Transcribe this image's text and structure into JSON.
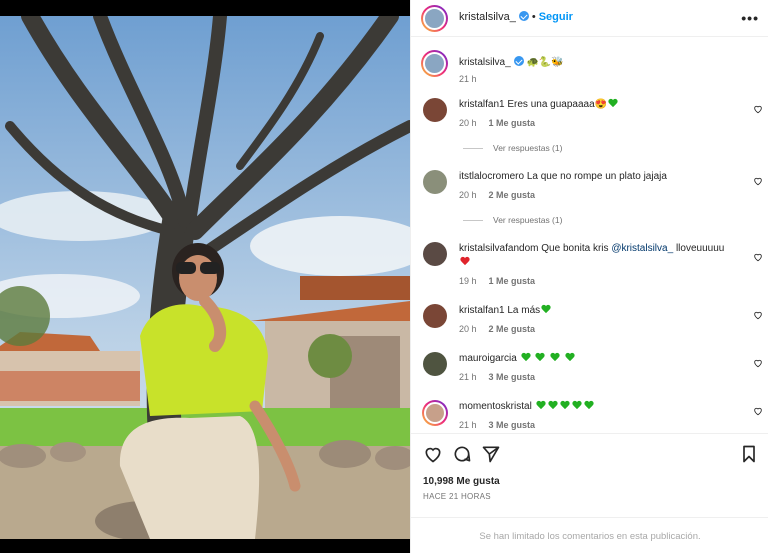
{
  "header": {
    "username": "kristalsilva_",
    "follow_label": "Seguir",
    "more_label": "•••"
  },
  "caption": {
    "username": "kristalsilva_",
    "emojis": "🐢🐍🐝",
    "time": "21 h"
  },
  "comments": [
    {
      "user": "kristalfan1",
      "text": "Eres una guapaaaa😍",
      "time": "20 h",
      "likes": "1 Me gusta",
      "replies": "Ver respuestas (1)"
    },
    {
      "user": "itstlalocromero",
      "text": "La que no rompe un plato jajaja",
      "time": "20 h",
      "likes": "2 Me gusta",
      "replies": "Ver respuestas (1)"
    },
    {
      "user": "kristalsilvafandom",
      "text": "Que bonita kris",
      "mention": "@kristalsilva_",
      "text2": "lloveuuuuu",
      "time": "19 h",
      "likes": "1 Me gusta"
    },
    {
      "user": "kristalfan1",
      "text": "La más",
      "time": "20 h",
      "likes": "2 Me gusta"
    },
    {
      "user": "mauroigarcia",
      "text": "",
      "time": "21 h",
      "likes": "3 Me gusta"
    },
    {
      "user": "momentoskristal",
      "text": "",
      "time": "21 h",
      "likes": "3 Me gusta"
    }
  ],
  "footer": {
    "likes": "10,998 Me gusta",
    "ago": "HACE 21 HORAS",
    "limited": "Se han limitado los comentarios en esta publicación."
  },
  "colors": {
    "link_blue": "#0095f6",
    "heart_green": "#22b022",
    "heart_red": "#e0242c"
  }
}
